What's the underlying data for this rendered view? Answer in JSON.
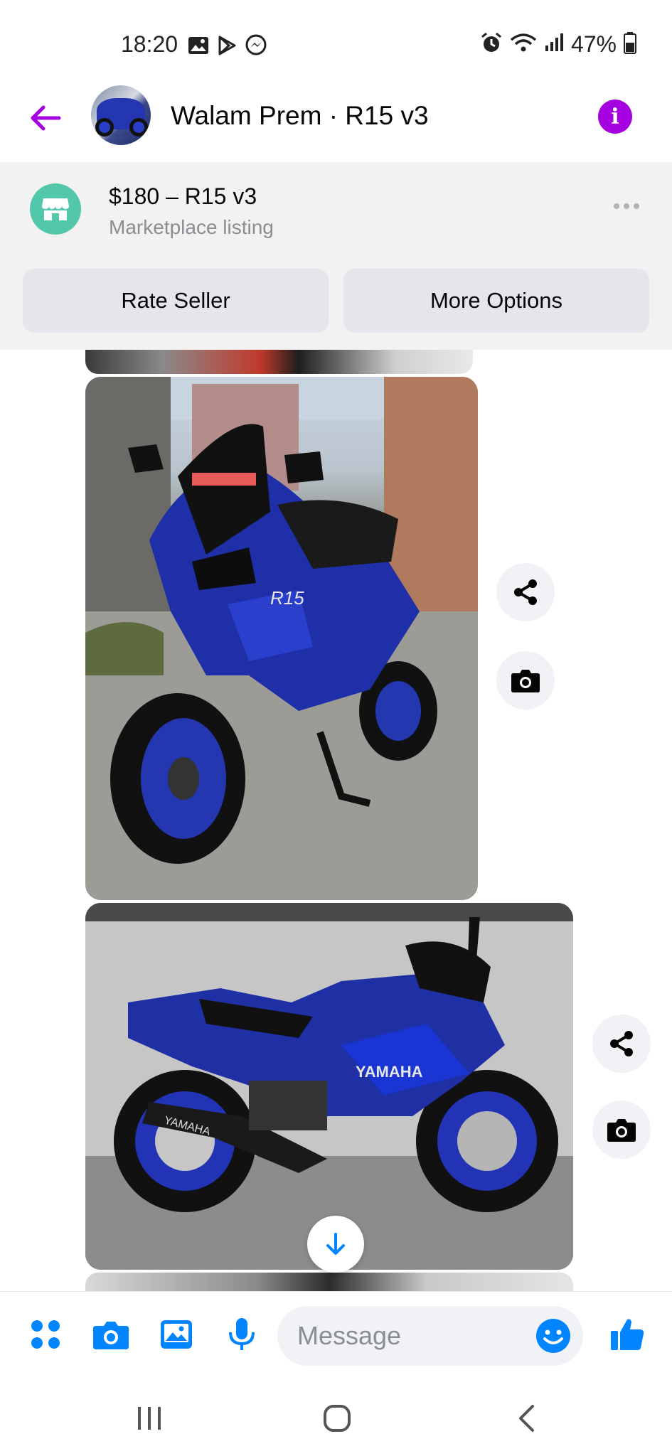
{
  "status_bar": {
    "time": "18:20",
    "battery": "47%",
    "left_icons": [
      "gallery-icon",
      "play-store-icon",
      "messenger-icon"
    ],
    "right_icons": [
      "alarm-icon",
      "wifi-icon",
      "signal-icon",
      "battery-icon"
    ]
  },
  "header": {
    "title": "Walam Prem · R15 v3",
    "accent_color": "#a500e0"
  },
  "listing": {
    "title": "$180 – R15 v3",
    "subtitle": "Marketplace listing",
    "rate_button": "Rate Seller",
    "more_button": "More Options",
    "icon_color": "#53c7a9"
  },
  "chat": {
    "messages": [
      {
        "type": "photo",
        "icons": [
          "share-icon",
          "camera-icon"
        ]
      },
      {
        "type": "photo",
        "icons": [
          "share-icon",
          "camera-icon"
        ]
      }
    ]
  },
  "composer": {
    "placeholder": "Message",
    "accent_color": "#0084ff"
  },
  "navbar": {
    "icons": [
      "recent-apps-icon",
      "home-icon",
      "back-icon"
    ]
  }
}
